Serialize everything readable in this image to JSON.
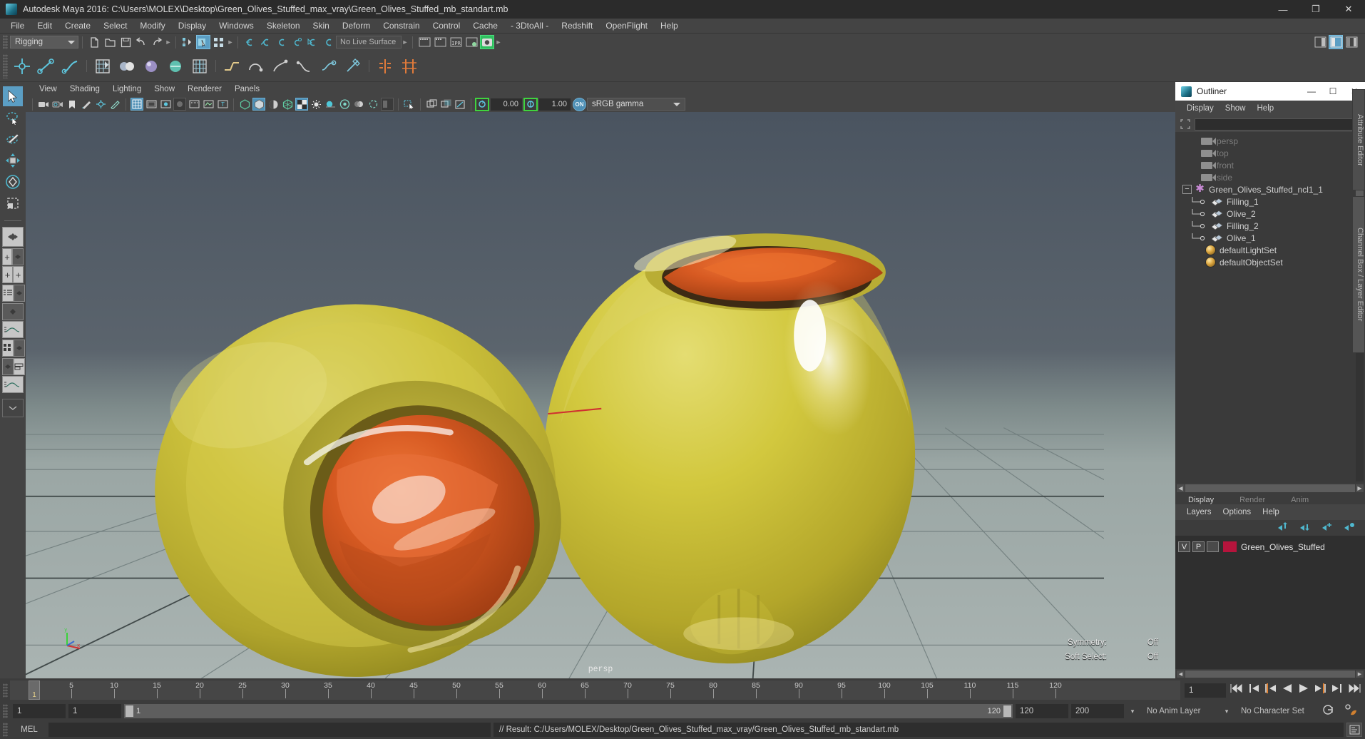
{
  "window": {
    "title": "Autodesk Maya 2016: C:\\Users\\MOLEX\\Desktop\\Green_Olives_Stuffed_max_vray\\Green_Olives_Stuffed_mb_standart.mb",
    "minimize": "—",
    "maximize": "❐",
    "close": "✕"
  },
  "menubar": {
    "items": [
      "File",
      "Edit",
      "Create",
      "Select",
      "Modify",
      "Display",
      "Windows",
      "Skeleton",
      "Skin",
      "Deform",
      "Constrain",
      "Control",
      "Cache",
      "- 3DtoAll -",
      "Redshift",
      "OpenFlight",
      "Help"
    ]
  },
  "statusline": {
    "menuset": "Rigging",
    "live_surface": "No Live Surface"
  },
  "viewport_menu": {
    "items": [
      "View",
      "Shading",
      "Lighting",
      "Show",
      "Renderer",
      "Panels"
    ]
  },
  "viewport_tools": {
    "exposure_value": "0.00",
    "gamma_value": "1.00",
    "color_profile": "sRGB gamma",
    "view_gate_on": "ON"
  },
  "viewport": {
    "camera_label": "persp",
    "hud": [
      {
        "label": "Symmetry:",
        "value": "Off"
      },
      {
        "label": "Soft Select:",
        "value": "Off"
      }
    ]
  },
  "outliner": {
    "title": "Outliner",
    "window_buttons": {
      "min": "—",
      "max": "☐",
      "close": "✕"
    },
    "menus": [
      "Display",
      "Show",
      "Help"
    ],
    "search_placeholder": "",
    "search_value": "",
    "items": [
      {
        "label": "persp",
        "icon": "camera-icon",
        "type": "camera",
        "indent": 1,
        "dim": true
      },
      {
        "label": "top",
        "icon": "camera-icon",
        "type": "camera",
        "indent": 1,
        "dim": true
      },
      {
        "label": "front",
        "icon": "camera-icon",
        "type": "camera",
        "indent": 1,
        "dim": true
      },
      {
        "label": "side",
        "icon": "camera-icon",
        "type": "camera",
        "indent": 1,
        "dim": true
      },
      {
        "label": "Green_Olives_Stuffed_ncl1_1",
        "icon": "asterisk-icon",
        "type": "group",
        "indent": 0,
        "dim": false,
        "expander": "−"
      },
      {
        "label": "Filling_1",
        "icon": "mesh-icon",
        "type": "mesh",
        "indent": 2,
        "dim": false
      },
      {
        "label": "Olive_2",
        "icon": "mesh-icon",
        "type": "mesh",
        "indent": 2,
        "dim": false
      },
      {
        "label": "Filling_2",
        "icon": "mesh-icon",
        "type": "mesh",
        "indent": 2,
        "dim": false
      },
      {
        "label": "Olive_1",
        "icon": "mesh-icon",
        "type": "mesh",
        "indent": 2,
        "dim": false
      },
      {
        "label": "defaultLightSet",
        "icon": "set-icon",
        "type": "set",
        "indent": 1,
        "dim": false
      },
      {
        "label": "defaultObjectSet",
        "icon": "set-icon",
        "type": "set",
        "indent": 1,
        "dim": false
      }
    ]
  },
  "channelbox": {
    "tabs": [
      "Display",
      "Render",
      "Anim"
    ],
    "active_tab": "Display",
    "layer_menus": [
      "Layers",
      "Options",
      "Help"
    ],
    "layers": [
      {
        "visible": "V",
        "playback": "P",
        "color": "#b5143c",
        "name": "Green_Olives_Stuffed"
      }
    ]
  },
  "dock_tabs": [
    "Attribute Editor",
    "Channel Box / Layer Editor"
  ],
  "timeline": {
    "ticks": [
      5,
      10,
      15,
      20,
      25,
      30,
      35,
      40,
      45,
      50,
      55,
      60,
      65,
      70,
      75,
      80,
      85,
      90,
      95,
      100,
      105,
      110,
      115,
      120
    ],
    "start": 1,
    "end": 120,
    "current_frame": "1",
    "playhead_label": "1"
  },
  "rangeslider": {
    "anim_start": "1",
    "range_start": "1",
    "range_bar_left": "1",
    "range_bar_right": "120",
    "range_end": "120",
    "anim_end": "200",
    "anim_layer": "No Anim Layer",
    "character_set": "No Character Set"
  },
  "commandline": {
    "label": "MEL",
    "input_value": "",
    "result": "// Result: C:/Users/MOLEX/Desktop/Green_Olives_Stuffed_max_vray/Green_Olives_Stuffed_mb_standart.mb"
  },
  "colors": {
    "accent_blue": "#5b9ec4",
    "panel_bg": "#444444",
    "dark_bg": "#2e2e2e",
    "olive_body": "#cfc23a",
    "olive_filling": "#d4581f",
    "layer_swatch": "#b5143c"
  }
}
